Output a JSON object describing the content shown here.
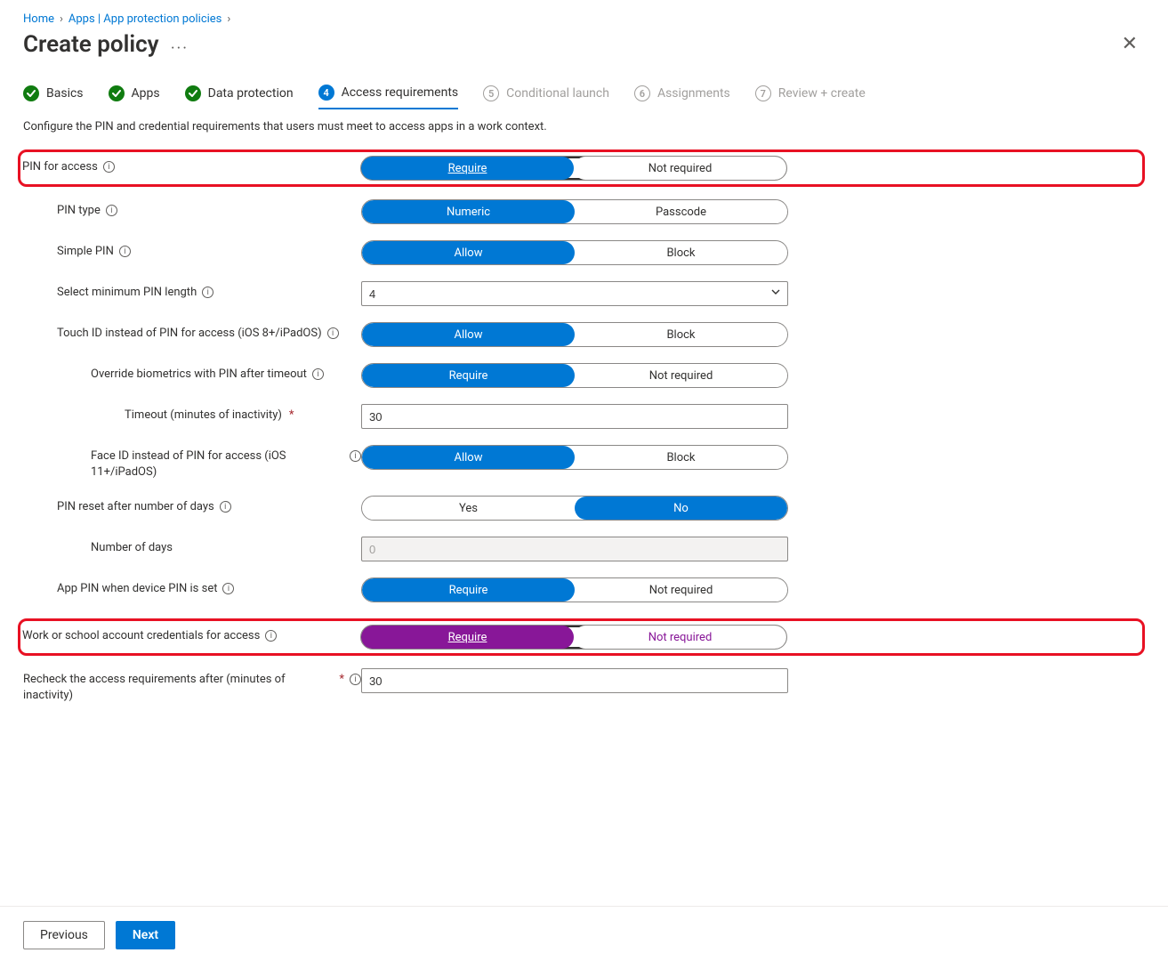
{
  "breadcrumb": {
    "home": "Home",
    "apps": "Apps | App protection policies"
  },
  "title": "Create policy",
  "steps": [
    {
      "num": "1",
      "label": "Basics",
      "state": "done"
    },
    {
      "num": "2",
      "label": "Apps",
      "state": "done"
    },
    {
      "num": "3",
      "label": "Data protection",
      "state": "done"
    },
    {
      "num": "4",
      "label": "Access requirements",
      "state": "active"
    },
    {
      "num": "5",
      "label": "Conditional launch",
      "state": "pending"
    },
    {
      "num": "6",
      "label": "Assignments",
      "state": "pending"
    },
    {
      "num": "7",
      "label": "Review + create",
      "state": "pending"
    }
  ],
  "subtitle": "Configure the PIN and credential requirements that users must meet to access apps in a work context.",
  "options": {
    "require": "Require",
    "not_required": "Not required",
    "numeric": "Numeric",
    "passcode": "Passcode",
    "allow": "Allow",
    "block": "Block",
    "yes": "Yes",
    "no": "No"
  },
  "labels": {
    "pin_for_access": "PIN for access",
    "pin_type": "PIN type",
    "simple_pin": "Simple PIN",
    "min_pin_length": "Select minimum PIN length",
    "touch_id": "Touch ID instead of PIN for access (iOS 8+/iPadOS)",
    "override_bio": "Override biometrics with PIN after timeout",
    "timeout_min": "Timeout (minutes of inactivity)",
    "face_id": "Face ID instead of PIN for access (iOS 11+/iPadOS)",
    "pin_reset_days": "PIN reset after number of days",
    "num_days": "Number of days",
    "app_pin_device": "App PIN when device PIN is set",
    "work_school_creds": "Work or school account credentials for access",
    "recheck": "Recheck the access requirements after (minutes of inactivity)"
  },
  "values": {
    "min_pin_length": "4",
    "timeout_min": "30",
    "num_days": "0",
    "recheck": "30"
  },
  "footer": {
    "previous": "Previous",
    "next": "Next"
  }
}
